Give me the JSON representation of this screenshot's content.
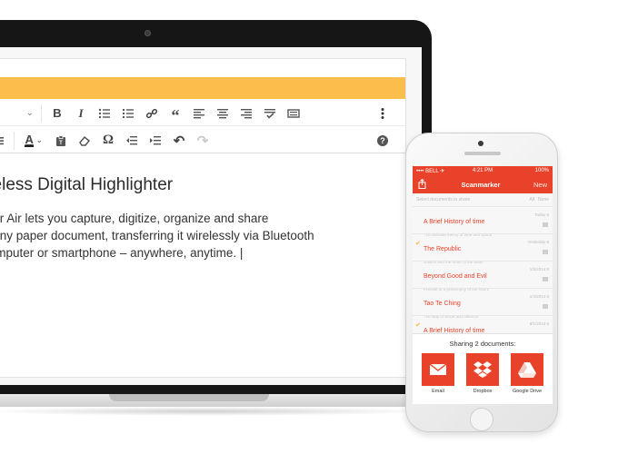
{
  "editor": {
    "format_select": "aph",
    "title": "ireless Digital Highlighter",
    "body_lines": [
      "rker Air lets you capture, digitize, organize and share",
      "n any paper document, transferring it wirelessly  via Bluetooth",
      "computer or smartphone – anywhere, anytime. |"
    ],
    "toolbar1_icons": [
      "bold-icon",
      "italic-icon",
      "bullet-list-icon",
      "numbered-list-icon",
      "link-icon",
      "blockquote-icon",
      "align-left-icon",
      "align-center-icon",
      "align-right-icon",
      "spellcheck-icon",
      "keyboard-icon",
      "more-vertical-icon"
    ],
    "toolbar2_icons": [
      "horizontal-rule-icon",
      "text-color-icon",
      "paste-text-icon",
      "eraser-icon",
      "special-char-icon",
      "outdent-icon",
      "indent-icon",
      "undo-icon",
      "redo-icon",
      "help-icon"
    ],
    "labels": {
      "bold": "B",
      "italic": "I",
      "quote": "“",
      "text_color": "A",
      "special_char": "Ω",
      "help": "?",
      "undo": "↶",
      "redo": "↷"
    },
    "accent_color": "#fbbd4c"
  },
  "phone": {
    "status_bar": {
      "carrier": "•••• BELL ✈",
      "time": "4:21 PM",
      "battery": "100%"
    },
    "nav": {
      "share_icon": "share-icon",
      "title": "Scanmarker",
      "new_label": "New"
    },
    "list_header": {
      "search_placeholder": "Select documents to share",
      "all_label": "All",
      "none_label": "None"
    },
    "documents": [
      {
        "title": "A Brief History of time",
        "checked": false,
        "date": "Today 8",
        "subtitle": "The ultimate theory of time and space"
      },
      {
        "title": "The Republic",
        "checked": true,
        "date": "Yesterday 8",
        "subtitle": "Justice and the order of the state"
      },
      {
        "title": "Beyond Good and Evil",
        "checked": false,
        "date": "1/5/2014 8",
        "subtitle": "Prelude to a philosophy of the future"
      },
      {
        "title": "Tao Te Ching",
        "checked": false,
        "date": "1/4/2014 8",
        "subtitle": "The way of virtue and balance"
      },
      {
        "title": "A Brief History of time",
        "checked": true,
        "date": "8/1/2013 8",
        "subtitle": ""
      }
    ],
    "share_panel": {
      "title": "Sharing 2 documents:",
      "options": [
        {
          "label": "Email",
          "icon": "email-icon"
        },
        {
          "label": "Dropbox",
          "icon": "dropbox-icon"
        },
        {
          "label": "Google Drive",
          "icon": "google-drive-icon"
        }
      ]
    },
    "brand_color": "#e8432a"
  }
}
